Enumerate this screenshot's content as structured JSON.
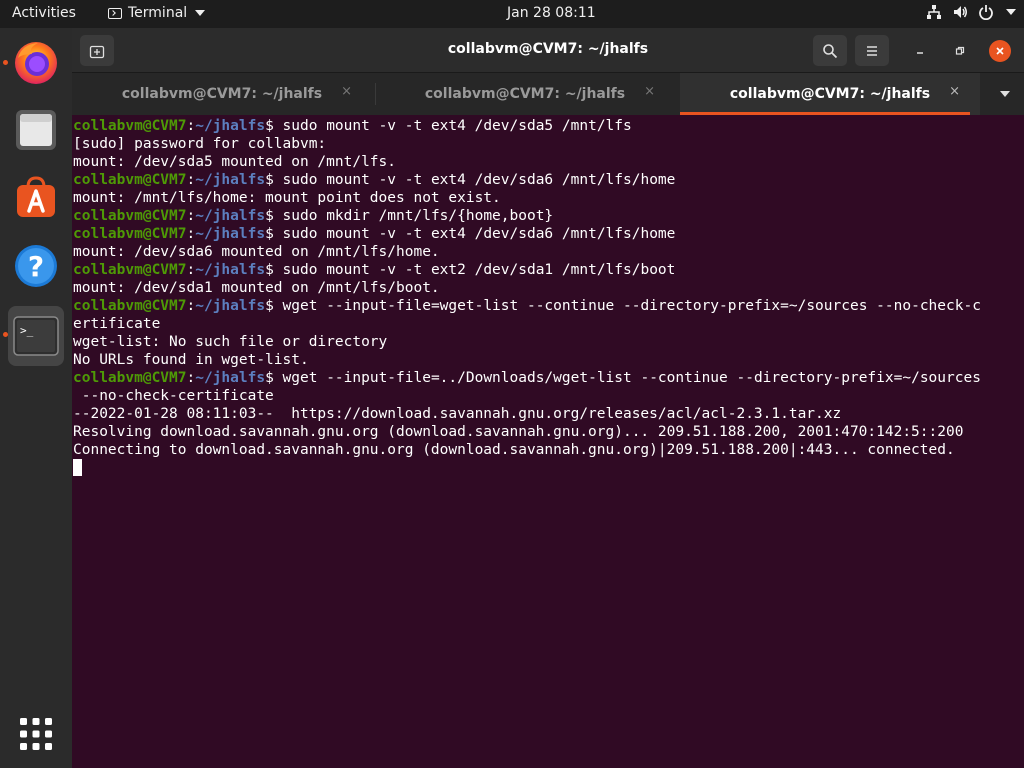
{
  "topbar": {
    "activities": "Activities",
    "app_name": "Terminal",
    "clock": "Jan 28  08:11"
  },
  "dock": {
    "items": [
      {
        "name": "firefox-icon",
        "running": true
      },
      {
        "name": "files-icon",
        "running": false
      },
      {
        "name": "software-center-icon",
        "running": false
      },
      {
        "name": "help-icon",
        "running": false
      },
      {
        "name": "terminal-icon",
        "running": true,
        "active": true
      },
      {
        "name": "show-apps-grid-icon",
        "running": false
      }
    ]
  },
  "window": {
    "title": "collabvm@CVM7: ~/jhalfs",
    "tabs": [
      {
        "label": "collabvm@CVM7: ~/jhalfs",
        "close": "×"
      },
      {
        "label": "collabvm@CVM7: ~/jhalfs",
        "close": "×"
      },
      {
        "label": "collabvm@CVM7: ~/jhalfs",
        "close": "×",
        "active": true
      }
    ]
  },
  "terminal": {
    "prompt_user": "collabvm@CVM7",
    "prompt_path": "~/jhalfs",
    "lines": [
      {
        "prompt": true,
        "text": " sudo mount -v -t ext4 /dev/sda5 /mnt/lfs"
      },
      {
        "prompt": false,
        "text": "[sudo] password for collabvm:"
      },
      {
        "prompt": false,
        "text": "mount: /dev/sda5 mounted on /mnt/lfs."
      },
      {
        "prompt": true,
        "text": " sudo mount -v -t ext4 /dev/sda6 /mnt/lfs/home"
      },
      {
        "prompt": false,
        "text": "mount: /mnt/lfs/home: mount point does not exist."
      },
      {
        "prompt": true,
        "text": " sudo mkdir /mnt/lfs/{home,boot}"
      },
      {
        "prompt": true,
        "text": " sudo mount -v -t ext4 /dev/sda6 /mnt/lfs/home"
      },
      {
        "prompt": false,
        "text": "mount: /dev/sda6 mounted on /mnt/lfs/home."
      },
      {
        "prompt": true,
        "text": " sudo mount -v -t ext2 /dev/sda1 /mnt/lfs/boot"
      },
      {
        "prompt": false,
        "text": "mount: /dev/sda1 mounted on /mnt/lfs/boot."
      },
      {
        "prompt": true,
        "text": " wget --input-file=wget-list --continue --directory-prefix=~/sources --no-check-c"
      },
      {
        "prompt": false,
        "text": "ertificate"
      },
      {
        "prompt": false,
        "text": "wget-list: No such file or directory"
      },
      {
        "prompt": false,
        "text": "No URLs found in wget-list."
      },
      {
        "prompt": true,
        "text": " wget --input-file=../Downloads/wget-list --continue --directory-prefix=~/sources"
      },
      {
        "prompt": false,
        "text": " --no-check-certificate"
      },
      {
        "prompt": false,
        "text": "--2022-01-28 08:11:03--  https://download.savannah.gnu.org/releases/acl/acl-2.3.1.tar.xz"
      },
      {
        "prompt": false,
        "text": "Resolving download.savannah.gnu.org (download.savannah.gnu.org)... 209.51.188.200, 2001:470:142:5::200"
      },
      {
        "prompt": false,
        "text": "Connecting to download.savannah.gnu.org (download.savannah.gnu.org)|209.51.188.200|:443... connected."
      }
    ]
  },
  "colors": {
    "terminal_bg": "#300a24",
    "prompt_user": "#4e9a06",
    "prompt_path": "#5c7fbf",
    "accent": "#e95420"
  }
}
